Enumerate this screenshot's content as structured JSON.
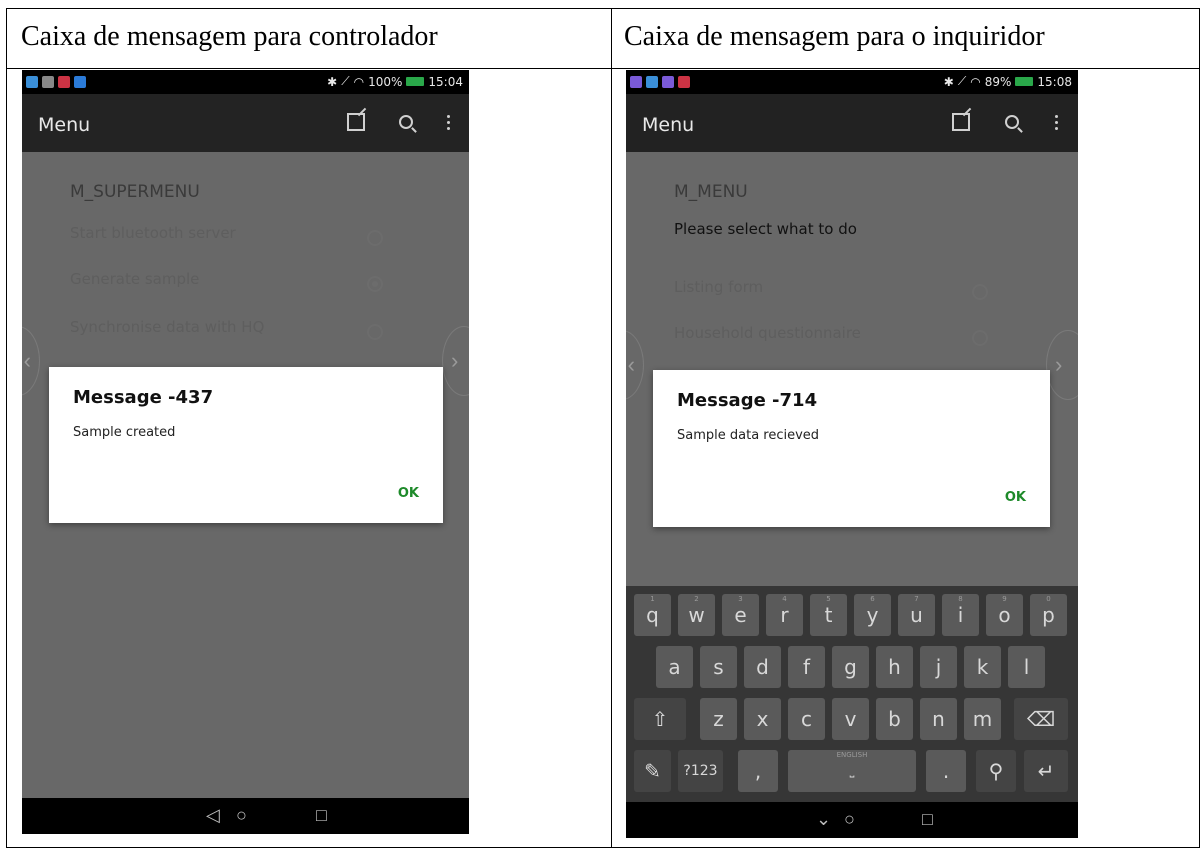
{
  "table": {
    "left_header": "Caixa de mensagem para controlador",
    "right_header": "Caixa de mensagem para o inquiridor"
  },
  "left_phone": {
    "status": {
      "battery": "100%",
      "time": "15:04"
    },
    "app_title": "Menu",
    "form_title": "M_SUPERMENU",
    "options": [
      {
        "label": "Start bluetooth server",
        "checked": false
      },
      {
        "label": "Generate sample",
        "checked": true
      },
      {
        "label": "Synchronise data with HQ",
        "checked": false
      }
    ],
    "dialog": {
      "title": "Message -437",
      "body": "Sample created",
      "ok": "OK"
    }
  },
  "right_phone": {
    "status": {
      "battery": "89%",
      "time": "15:08"
    },
    "app_title": "Menu",
    "form_title": "M_MENU",
    "prompt": "Please select what to do",
    "options": [
      {
        "label": "Listing form",
        "checked": false
      },
      {
        "label": "Household questionnaire",
        "checked": false
      }
    ],
    "dialog": {
      "title": "Message -714",
      "body": "Sample data recieved",
      "ok": "OK"
    },
    "keyboard": {
      "row1": [
        "q",
        "w",
        "e",
        "r",
        "t",
        "y",
        "u",
        "i",
        "o",
        "p"
      ],
      "row1_hints": [
        "1",
        "2",
        "3",
        "4",
        "5",
        "6",
        "7",
        "8",
        "9",
        "0"
      ],
      "row2": [
        "a",
        "s",
        "d",
        "f",
        "g",
        "h",
        "j",
        "k",
        "l"
      ],
      "row3": [
        "z",
        "x",
        "c",
        "v",
        "b",
        "n",
        "m"
      ],
      "symbols_key": "?123",
      "comma_key": ",",
      "period_key": ".",
      "space_hint": "ENGLISH"
    }
  },
  "colors": {
    "accent_ok": "#1e8a2a",
    "dim_overlay": "#686868",
    "app_bar": "#222222"
  }
}
